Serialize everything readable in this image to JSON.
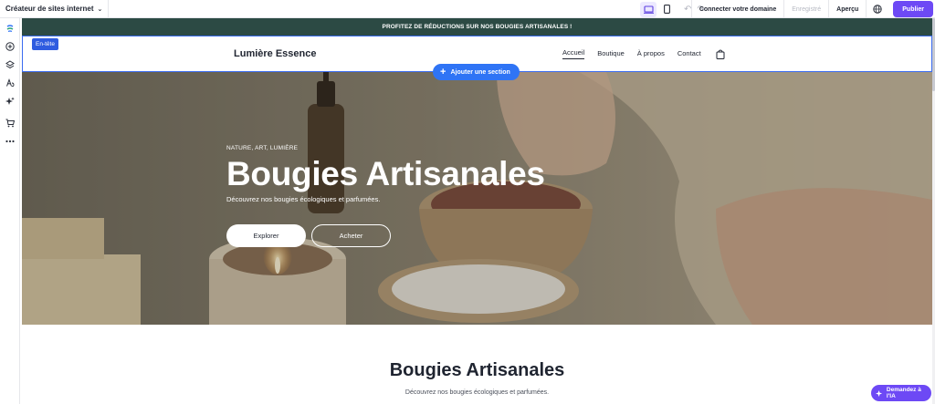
{
  "toolbar": {
    "builder_label": "Créateur de sites internet",
    "connect_domain": "Connecter votre domaine",
    "saved_status": "Enregistré",
    "preview": "Aperçu",
    "publish": "Publier"
  },
  "site": {
    "announcement": "PROFITEZ DE RÉDUCTIONS SUR NOS BOUGIES ARTISANALES !",
    "header_tag": "En-tête",
    "brand": "Lumière Essence",
    "nav": [
      "Accueil",
      "Boutique",
      "À propos",
      "Contact"
    ],
    "add_section": "Ajouter une section"
  },
  "hero": {
    "kicker": "NATURE, ART, LUMIÈRE",
    "title": "Bougies Artisanales",
    "subtitle": "Découvrez nos bougies écologiques et parfumées.",
    "btn_primary": "Explorer",
    "btn_secondary": "Acheter"
  },
  "section2": {
    "title": "Bougies Artisanales",
    "subtitle": "Découvrez nos bougies écologiques et parfumées."
  },
  "ai_button": "Demandez à l'IA",
  "colors": {
    "accent": "#6d49f5",
    "announce_bg": "#2c4a44",
    "add_section": "#2f74f5"
  }
}
